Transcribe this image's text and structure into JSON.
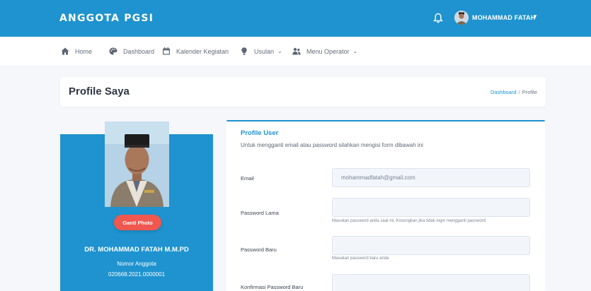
{
  "app": {
    "brand": "ANGGOTA PGSI",
    "user_name": "MOHAMMAD FATAH",
    "icons": {
      "notification": "bell-icon",
      "user_menu": "caret-down-icon"
    }
  },
  "nav": {
    "items": [
      {
        "label": "Home",
        "icon": "home-icon"
      },
      {
        "label": "Dashboard",
        "icon": "palette-icon"
      },
      {
        "label": "Kalender Kegiatan",
        "icon": "calendar-icon"
      },
      {
        "label": "Usulan",
        "icon": "lightbulb-icon",
        "has_dropdown": true
      },
      {
        "label": "Menu Operator",
        "icon": "users-icon",
        "has_dropdown": true
      }
    ]
  },
  "page": {
    "title": "Profile Saya",
    "breadcrumb": {
      "parent": "Dashboard",
      "separator": "/",
      "current": "Profile"
    }
  },
  "profile": {
    "change_photo_label": "Ganti Photo",
    "name": "DR. MOHAMMAD FATAH M.M.PD",
    "member_label": "Nomor Anggota",
    "member_number": "020668.2021.0000001"
  },
  "form": {
    "heading": "Profile User",
    "description": "Untuk mengganti email atau password silahkan mengisi form dibawah ini",
    "email": {
      "label": "Email",
      "value": "mohammadfatah@gmail.com"
    },
    "old_password": {
      "label": "Password Lama",
      "value": "",
      "help": "Masukan password anda saat ini, Kosongkan jika tidak ingin mengganti password"
    },
    "new_password": {
      "label": "Password Baru",
      "value": "",
      "help": "Masukan password baru anda"
    },
    "confirm_password": {
      "label": "Konfirmasi Password Baru",
      "value": ""
    }
  },
  "colors": {
    "primary": "#1e93cf",
    "button": "#f0574f",
    "background": "#f5f7fb"
  }
}
